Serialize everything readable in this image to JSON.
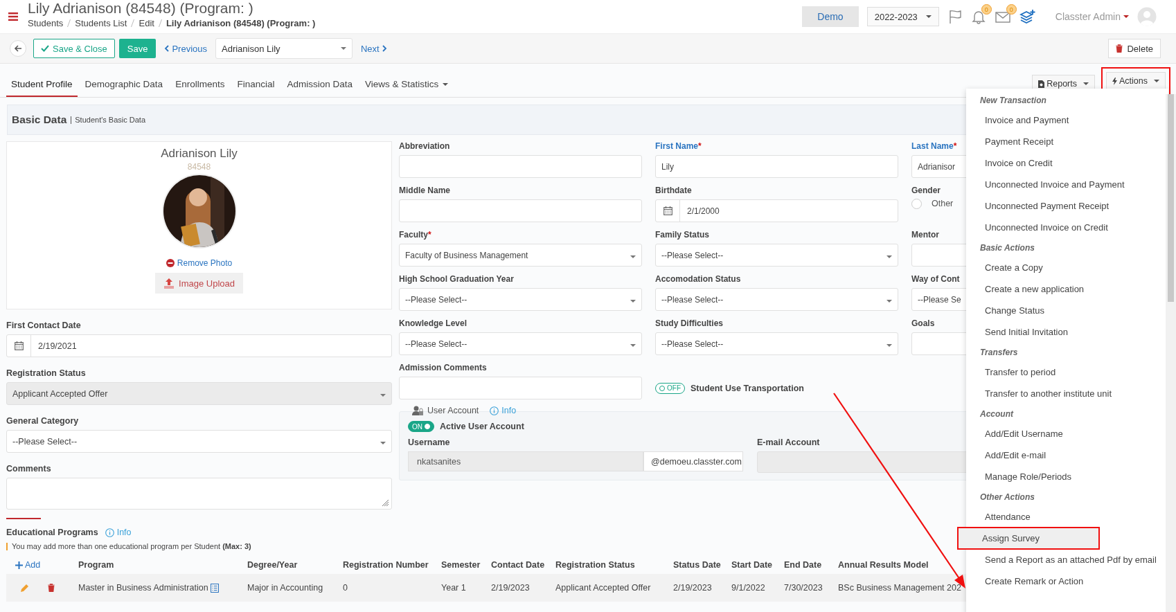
{
  "header": {
    "title": "Lily Adrianison (84548) (Program: )",
    "breadcrumb": [
      "Students",
      "Students List",
      "Edit",
      "Lily Adrianison (84548) (Program: )"
    ],
    "environment": "Demo",
    "year": "2022-2023",
    "notifications": "0",
    "messages": "0",
    "user": "Classter Admin"
  },
  "toolbar": {
    "save_close": "Save & Close",
    "save": "Save",
    "previous": "Previous",
    "record": "Adrianison Lily",
    "next": "Next",
    "delete": "Delete"
  },
  "tabs": [
    {
      "label": "Student Profile",
      "selected": true,
      "dropdown": false
    },
    {
      "label": "Demographic Data",
      "selected": false,
      "dropdown": false
    },
    {
      "label": "Enrollments",
      "selected": false,
      "dropdown": false
    },
    {
      "label": "Financial",
      "selected": false,
      "dropdown": false
    },
    {
      "label": "Admission Data",
      "selected": false,
      "dropdown": false
    },
    {
      "label": "Views & Statistics",
      "selected": false,
      "dropdown": true
    }
  ],
  "tab_actions": [
    {
      "kind": "reports",
      "label": "Reports",
      "highlighted": false
    },
    {
      "kind": "actions",
      "label": "Actions",
      "highlighted": true
    }
  ],
  "section": {
    "title": "Basic Data",
    "subtitle": "Student's Basic Data"
  },
  "profile": {
    "name": "Adrianison Lily",
    "id": "84548",
    "remove_photo": "Remove Photo",
    "upload": "Image Upload"
  },
  "left_fields": [
    {
      "kind": "date",
      "label": "First Contact Date",
      "value": "2/19/2021"
    },
    {
      "kind": "select",
      "label": "Registration Status",
      "value": "Applicant Accepted Offer",
      "disabled": true
    },
    {
      "kind": "select",
      "label": "General Category",
      "value": "--Please Select--",
      "disabled": false
    },
    {
      "kind": "textarea",
      "label": "Comments"
    }
  ],
  "form_fields": [
    {
      "kind": "text",
      "label": "Abbreviation",
      "accent": false
    },
    {
      "kind": "text",
      "label": "First Name",
      "mark": "*",
      "value": "Lily",
      "accent": true
    },
    {
      "kind": "text",
      "label": "Last Name",
      "mark": "*",
      "value": "Adrianisor",
      "accent": true
    },
    {
      "kind": "text",
      "label": "Middle Name",
      "accent": false
    },
    {
      "kind": "date",
      "label": "Birthdate",
      "value": "2/1/2000",
      "accent": false
    },
    {
      "kind": "radio",
      "label": "Gender",
      "option": "Other",
      "checked": false,
      "accent": false
    },
    {
      "kind": "select",
      "label": "Faculty",
      "mark": "*",
      "value": "Faculty of Business Management",
      "accent": false
    },
    {
      "kind": "select",
      "label": "Family Status",
      "value": "--Please Select--",
      "accent": false
    },
    {
      "kind": "text",
      "label": "Mentor",
      "accent": false
    },
    {
      "kind": "select",
      "label": "High School Graduation Year",
      "value": "--Please Select--",
      "accent": false
    },
    {
      "kind": "select",
      "label": "Accomodation Status",
      "value": "--Please Select--",
      "accent": false
    },
    {
      "kind": "select",
      "label": "Way of Cont",
      "value": "--Please Se",
      "accent": false
    },
    {
      "kind": "select",
      "label": "Knowledge Level",
      "value": "--Please Select--",
      "accent": false
    },
    {
      "kind": "select",
      "label": "Study Difficulties",
      "value": "--Please Select--",
      "accent": false
    },
    {
      "kind": "text",
      "label": "Goals",
      "accent": false
    },
    {
      "kind": "text",
      "label": "Admission Comments",
      "accent": false
    },
    {
      "kind": "toggle",
      "label": "Student Use Transportation",
      "on": false,
      "state_text": "OFF"
    }
  ],
  "user_account": {
    "title": "User Account",
    "info": "Info",
    "active_label": "Active User Account",
    "active": true,
    "active_text": "ON",
    "username_label": "Username",
    "username": "nkatsanites",
    "domain": "@demoeu.classter.com",
    "email_label": "E-mail Account"
  },
  "programs": {
    "title": "Educational Programs",
    "info": "Info",
    "note": "You may add more than one educational program per Student **(Max: 3)**",
    "add": "Add",
    "columns": [
      "Program",
      "Degree/Year",
      "Registration Number",
      "Semester",
      "Contact Date",
      "Registration Status",
      "Status Date",
      "Start Date",
      "End Date",
      "Annual Results Model"
    ],
    "rows": [
      {
        "cells": [
          "Master in Business Administration",
          "Major in Accounting",
          "0",
          "Year 1",
          "2/19/2023",
          "Applicant Accepted Offer",
          "2/19/2023",
          "9/1/2022",
          "7/30/2023",
          "BSc Business Management 202"
        ]
      }
    ]
  },
  "actions_menu": {
    "groups": [
      {
        "title": "New Transaction",
        "items": [
          {
            "label": "Invoice and Payment",
            "hovered": false,
            "highlighted": false
          },
          {
            "label": "Payment Receipt",
            "hovered": false,
            "highlighted": false
          },
          {
            "label": "Invoice on Credit",
            "hovered": false,
            "highlighted": false
          },
          {
            "label": "Unconnected Invoice and Payment",
            "hovered": false,
            "highlighted": false
          },
          {
            "label": "Unconnected Payment Receipt",
            "hovered": false,
            "highlighted": false
          },
          {
            "label": "Unconnected Invoice on Credit",
            "hovered": false,
            "highlighted": false
          }
        ]
      },
      {
        "title": "Basic Actions",
        "items": [
          {
            "label": "Create a Copy",
            "hovered": false,
            "highlighted": false
          },
          {
            "label": "Create a new application",
            "hovered": false,
            "highlighted": false
          },
          {
            "label": "Change Status",
            "hovered": false,
            "highlighted": false
          },
          {
            "label": "Send Initial Invitation",
            "hovered": false,
            "highlighted": false
          }
        ]
      },
      {
        "title": "Transfers",
        "items": [
          {
            "label": "Transfer to period",
            "hovered": false,
            "highlighted": false
          },
          {
            "label": "Transfer to another institute unit",
            "hovered": false,
            "highlighted": false
          }
        ]
      },
      {
        "title": "Account",
        "items": [
          {
            "label": "Add/Edit Username",
            "hovered": false,
            "highlighted": false
          },
          {
            "label": "Add/Edit e-mail",
            "hovered": false,
            "highlighted": false
          },
          {
            "label": "Manage Role/Periods",
            "hovered": false,
            "highlighted": false
          }
        ]
      },
      {
        "title": "Other Actions",
        "items": [
          {
            "label": "Attendance",
            "hovered": false,
            "highlighted": false
          },
          {
            "label": "Assign Survey",
            "hovered": true,
            "highlighted": true
          },
          {
            "label": "Send a Report as an attached Pdf by email",
            "hovered": false,
            "highlighted": false
          },
          {
            "label": "Create Remark or Action",
            "hovered": false,
            "highlighted": false
          }
        ]
      }
    ]
  },
  "annotation_arrow": true
}
